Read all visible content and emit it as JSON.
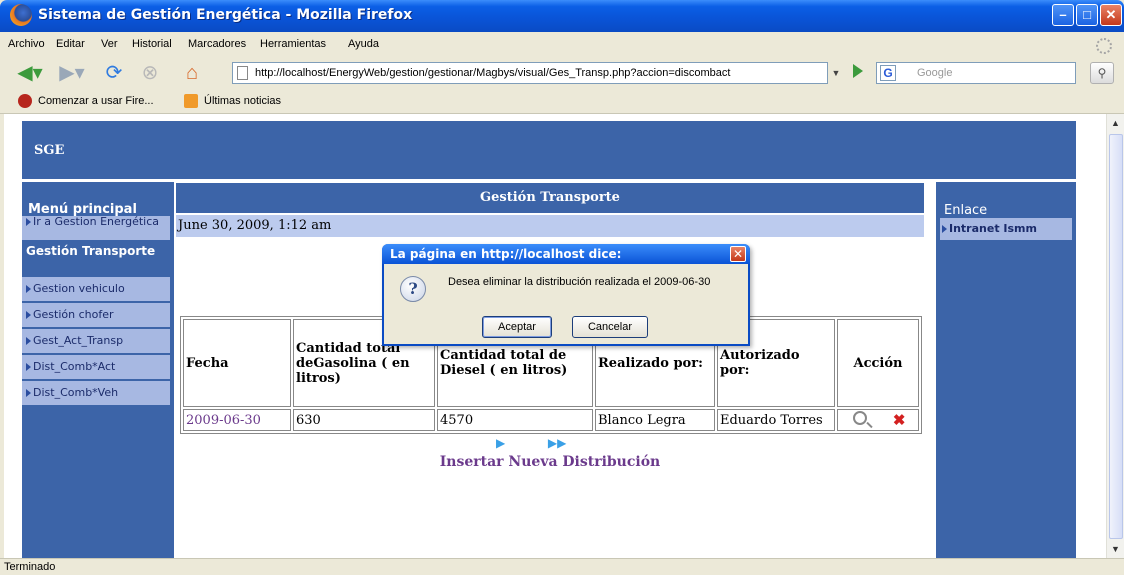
{
  "window": {
    "title": "Sistema de Gestión Energética - Mozilla Firefox"
  },
  "menubar": {
    "items": [
      "Archivo",
      "Editar",
      "Ver",
      "Historial",
      "Marcadores",
      "Herramientas",
      "Ayuda"
    ]
  },
  "navbar": {
    "url": "http://localhost/EnergyWeb/gestion/gestionar/Magbys/visual/Ges_Transp.php?accion=discombact",
    "search_placeholder": "Google"
  },
  "bookmarks": [
    {
      "label": "Comenzar a usar Fire...",
      "icon": "firefox-icon"
    },
    {
      "label": "Últimas noticias",
      "icon": "rss-icon"
    }
  ],
  "page": {
    "header": "SGE",
    "left_menu": {
      "title": "Menú principal",
      "item_top": "Ir a Gestion Energética",
      "section": "Gestión Transporte",
      "items": [
        "Gestion vehiculo",
        "Gestión chofer",
        "Gest_Act_Transp",
        "Dist_Comb*Act",
        "Dist_Comb*Veh"
      ]
    },
    "right_menu": {
      "title": "Enlace",
      "item": "Intranet Ismm"
    },
    "main_title": "Gestión Transporte",
    "date": "June 30, 2009, 1:12 am",
    "table": {
      "headers": [
        "Fecha",
        "Cantidad total deGasolina ( en litros)",
        "Cantidad total de Diesel ( en litros)",
        "Realizado por:",
        "Autorizado por:",
        "Acción"
      ],
      "rows": [
        {
          "fecha": "2009-06-30",
          "gasolina": "630",
          "diesel": "4570",
          "realizado": "Blanco Legra",
          "autorizado": "Eduardo Torres"
        }
      ]
    },
    "insert_link": "Insertar Nueva Distribución"
  },
  "dialog": {
    "title": "La página en http://localhost dice:",
    "message": "Desea eliminar la distribución realizada el 2009-06-30",
    "ok": "Aceptar",
    "cancel": "Cancelar"
  },
  "status": "Terminado"
}
